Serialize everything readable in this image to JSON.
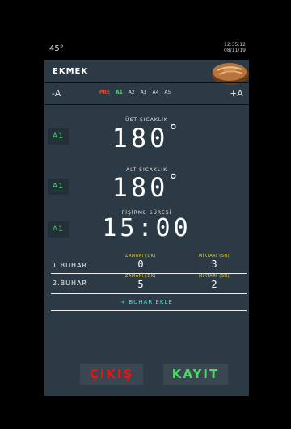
{
  "status": {
    "temperature": "45°",
    "time": "12:35:12",
    "date": "08/11/19"
  },
  "title": "EKMEK",
  "program": {
    "minus_label": "-A",
    "plus_label": "+A",
    "presets": [
      "PRE",
      "A1",
      "A2",
      "A3",
      "A4",
      "A5"
    ],
    "selected": "A1"
  },
  "sections": [
    {
      "badge": "A1",
      "label": "ÜST SICAKLIK",
      "value": "180",
      "unit": "°"
    },
    {
      "badge": "A1",
      "label": "ALT SICAKLIK",
      "value": "180",
      "unit": "°"
    },
    {
      "badge": "A1",
      "label": "PİŞİRME SÜRESİ",
      "value": "15:00",
      "unit": ""
    }
  ],
  "steam": {
    "col_time": "ZAMANI (DK)",
    "col_amount": "MİKTARI (SN)",
    "rows": [
      {
        "label": "1.BUHAR",
        "time": "0",
        "amount": "3"
      },
      {
        "label": "2.BUHAR",
        "time": "5",
        "amount": "2"
      }
    ],
    "add_label": "+ BUHAR EKLE"
  },
  "buttons": {
    "exit": "ÇIKIŞ",
    "save": "KAYIT"
  },
  "colors": {
    "background": "#2b3a45",
    "accent_green": "#4cd964",
    "exit_red": "#e21818",
    "steam_header_yellow": "#e8d23a",
    "add_cyan": "#3ee0e0"
  },
  "icons": {
    "product_image": "bread-icon"
  }
}
